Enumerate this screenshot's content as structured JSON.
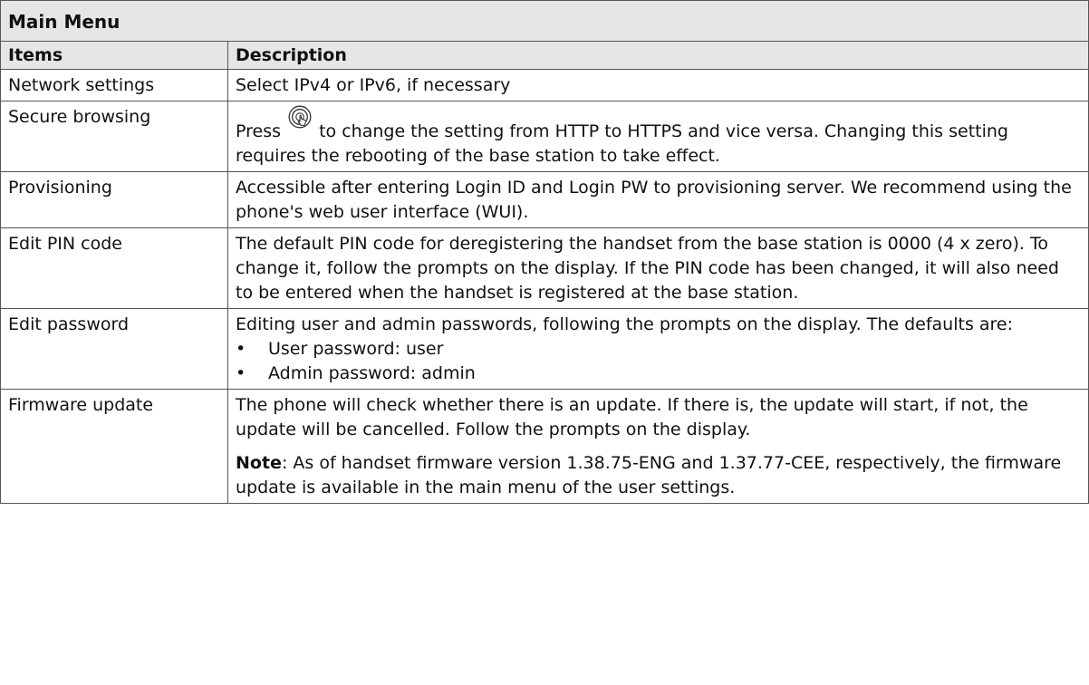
{
  "table": {
    "title": "Main Menu",
    "headers": {
      "items": "Items",
      "description": "Description"
    },
    "rows": [
      {
        "item": "Network settings",
        "description": "Select IPv4 or IPv6, if necessary"
      },
      {
        "item": "Secure browsing",
        "description_before_icon": "Press",
        "icon": "ok-button-icon",
        "description_after_icon": "to change the setting from HTTP to HTTPS and vice versa.  Changing this setting requires the rebooting of the base station to take effect."
      },
      {
        "item": "Provisioning",
        "description": "Accessible after entering Login ID and Login PW to provisioning server.  We recommend using the phone's web user interface (WUI)."
      },
      {
        "item": "Edit PIN code",
        "description": "The default PIN code for deregistering the handset from the base station is 0000 (4 x zero).  To change it, follow the prompts on the display.  If the PIN code has been changed, it will also need to be entered when the handset is registered at the base station."
      },
      {
        "item": "Edit password",
        "description": "Editing user and admin passwords, following the prompts on the display.  The defaults are:",
        "bullets": [
          "User password:  user",
          "Admin password:  admin"
        ],
        "bullet_glyph": "•"
      },
      {
        "item": "Firmware update",
        "description": "The phone will check whether there is an update.  If there is, the update will start, if not, the update will be cancelled.  Follow the prompts on the display.",
        "note_label": "Note",
        "note_text": ":  As of handset firmware version 1.38.75-ENG and 1.37.77-CEE, respectively, the firmware update is available in the main menu of the user settings."
      }
    ]
  },
  "colors": {
    "header_background": "#e6e6e6",
    "border": "#555555",
    "text": "#111111"
  }
}
